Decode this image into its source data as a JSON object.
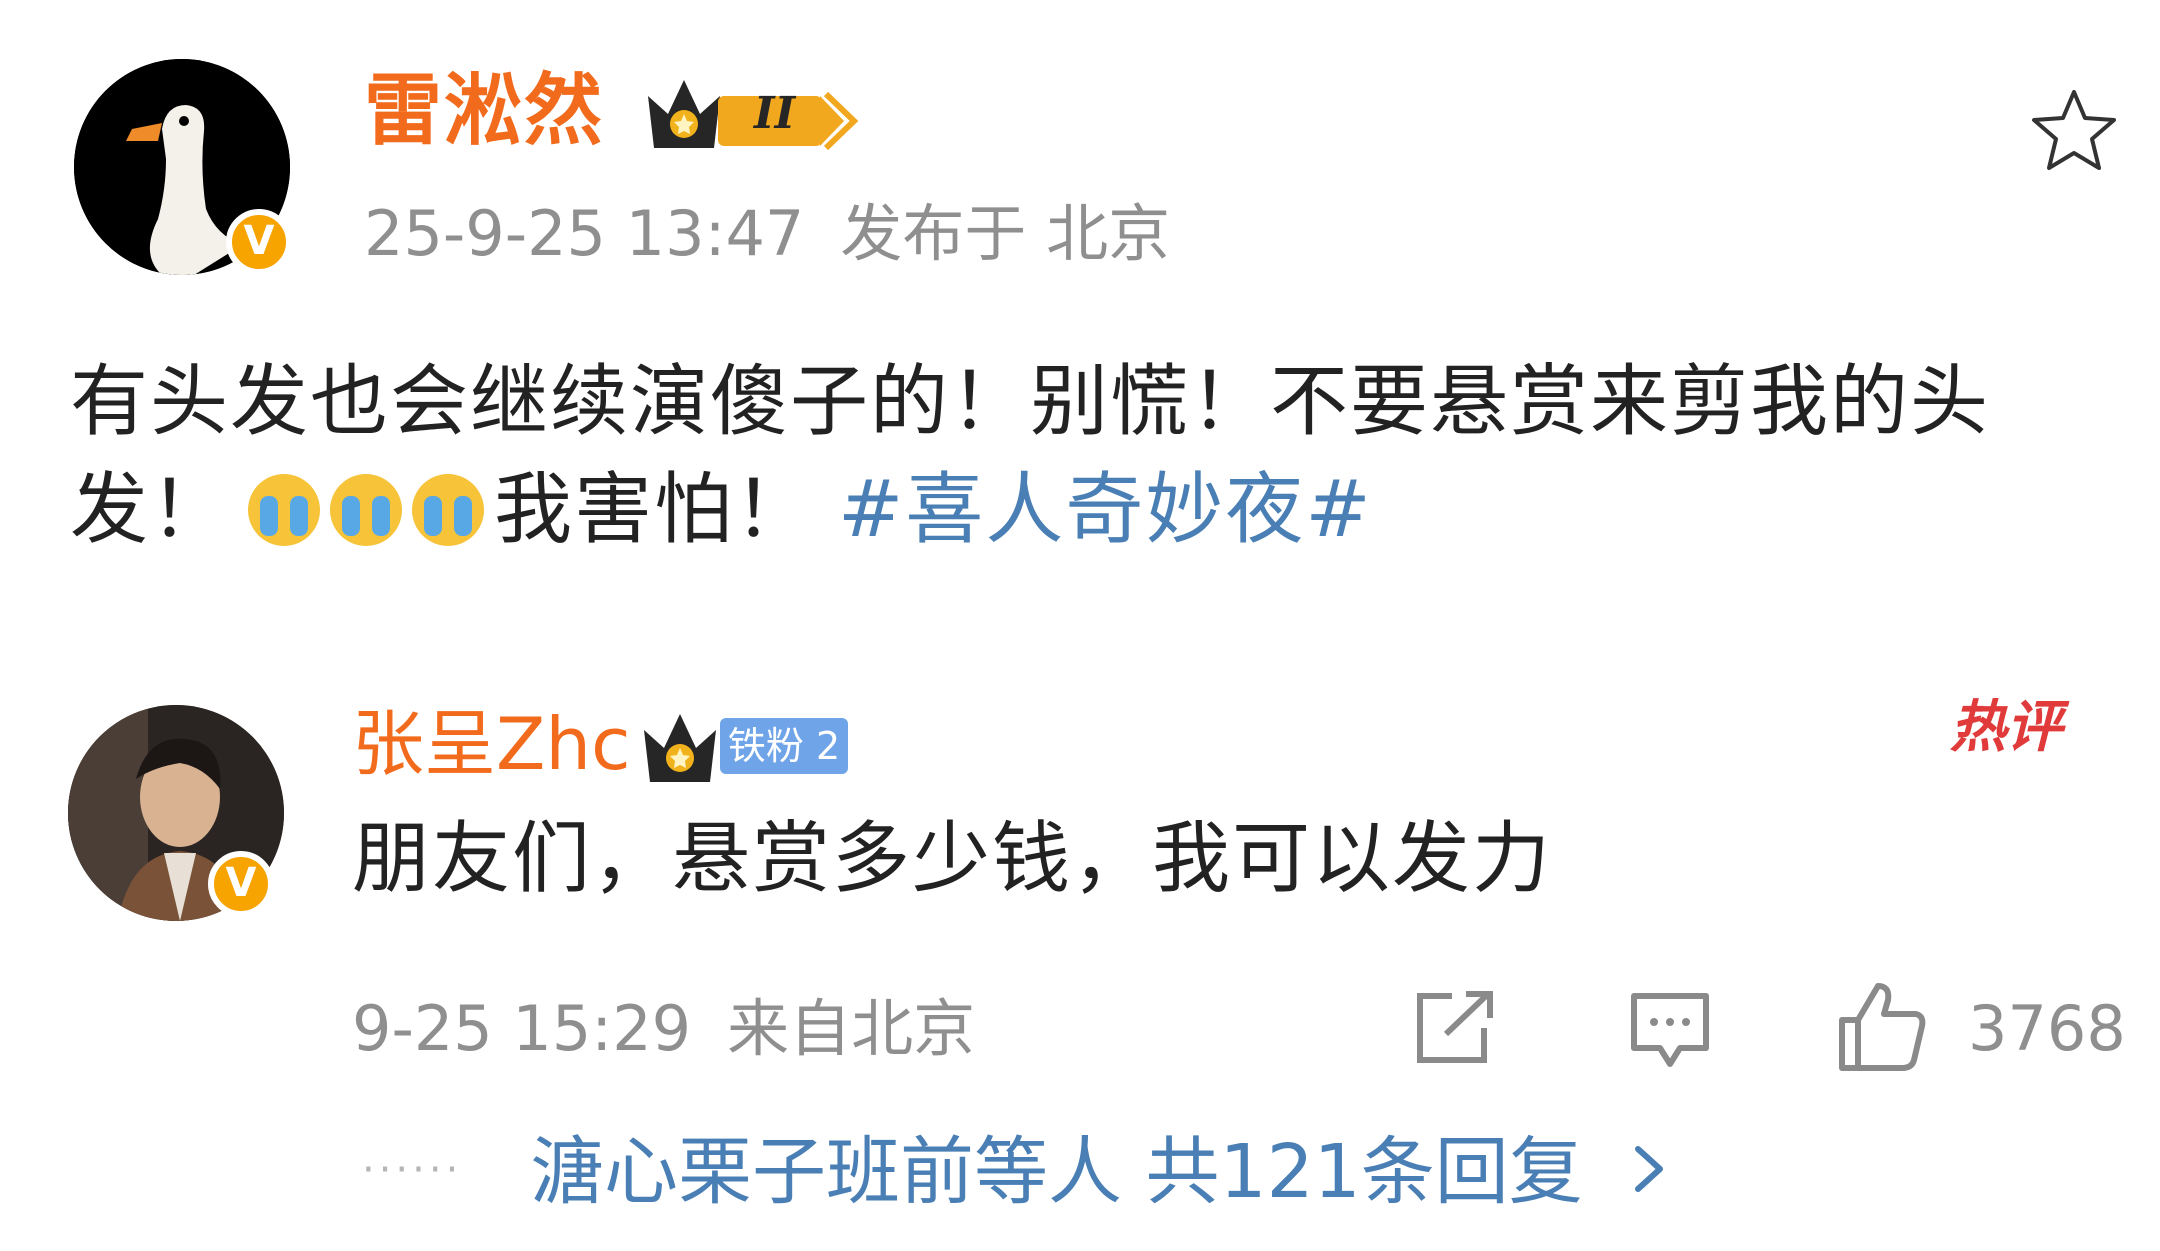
{
  "post": {
    "author_name": "雷淞然",
    "timestamp": "25-9-25 13:47",
    "location": "发布于 北京",
    "text": "有头发也会继续演傻子的！别慌！不要悬赏来剪我的头发！",
    "text_after_emoji": "我害怕！",
    "hashtag": "#喜人奇妙夜#",
    "emoji": [
      "crying-face",
      "crying-face",
      "crying-face"
    ],
    "level_badge": "II",
    "verified_badge": "V",
    "icons": [
      "avatar-goose",
      "crown-icon",
      "star-icon"
    ]
  },
  "comment": {
    "author_name": "张呈Zhc",
    "fan_badge": "铁粉 2",
    "hot_badge": "热评",
    "text": "朋友们，悬赏多少钱，我可以发力",
    "timestamp": "9-25 15:29",
    "location": "来自北京",
    "like_count": "3768",
    "verified_badge": "V",
    "icons": [
      "share-icon",
      "comment-icon",
      "like-icon"
    ]
  },
  "replies": {
    "label": "溏心栗子班前等人 共121条回复",
    "dots": "······"
  },
  "colors": {
    "author_orange": "#f26b1d",
    "link_blue": "#4a7fb5",
    "meta_gray": "#8f8f8f",
    "verified_gold": "#f7a300",
    "hot_red": "#e03a3a"
  }
}
